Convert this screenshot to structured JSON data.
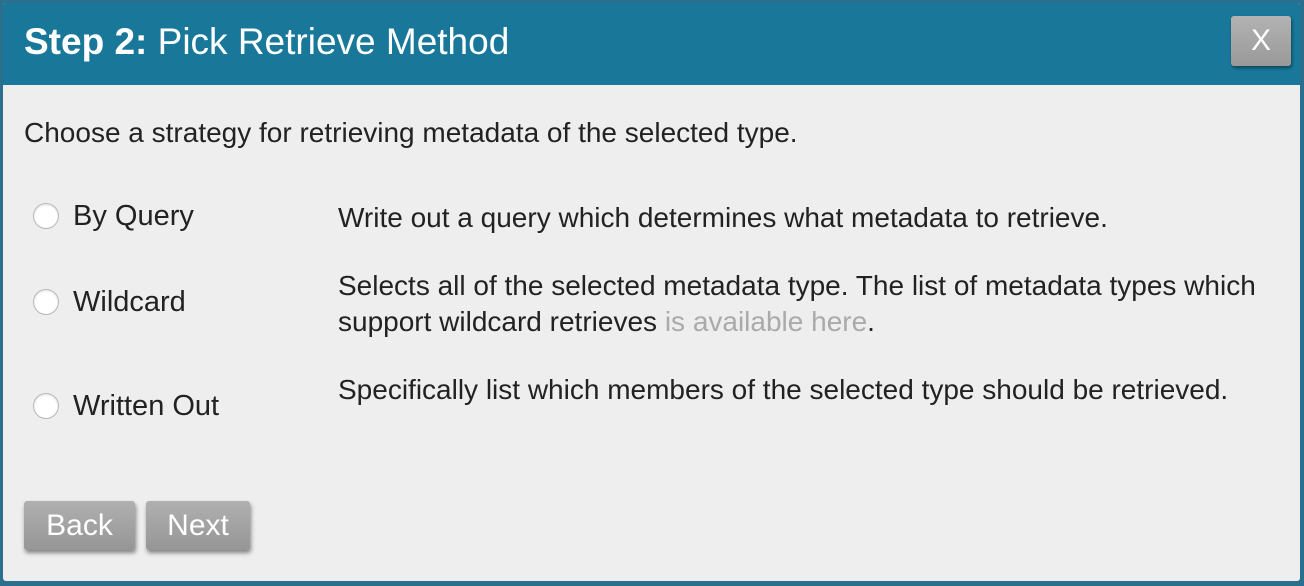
{
  "dialog": {
    "title_step": "Step 2:",
    "title_text": "Pick Retrieve Method",
    "close_label": "X"
  },
  "intro": "Choose a strategy for retrieving metadata of the selected type.",
  "options": [
    {
      "label": "By Query",
      "description": "Write out a query which determines what metadata to retrieve.",
      "selected": false
    },
    {
      "label": "Wildcard",
      "description_before": "Selects all of the selected metadata type. The list of metadata types which support wildcard retrieves ",
      "link_text": "is available here",
      "description_after": ".",
      "selected": false
    },
    {
      "label": "Written Out",
      "description": "Specifically list which members of the selected type should be retrieved.",
      "selected": false
    }
  ],
  "footer": {
    "back_label": "Back",
    "next_label": "Next"
  },
  "colors": {
    "header": "#19789a",
    "body": "#eeeeee",
    "button": "#a6a6a6",
    "link": "#aaaaaa"
  }
}
